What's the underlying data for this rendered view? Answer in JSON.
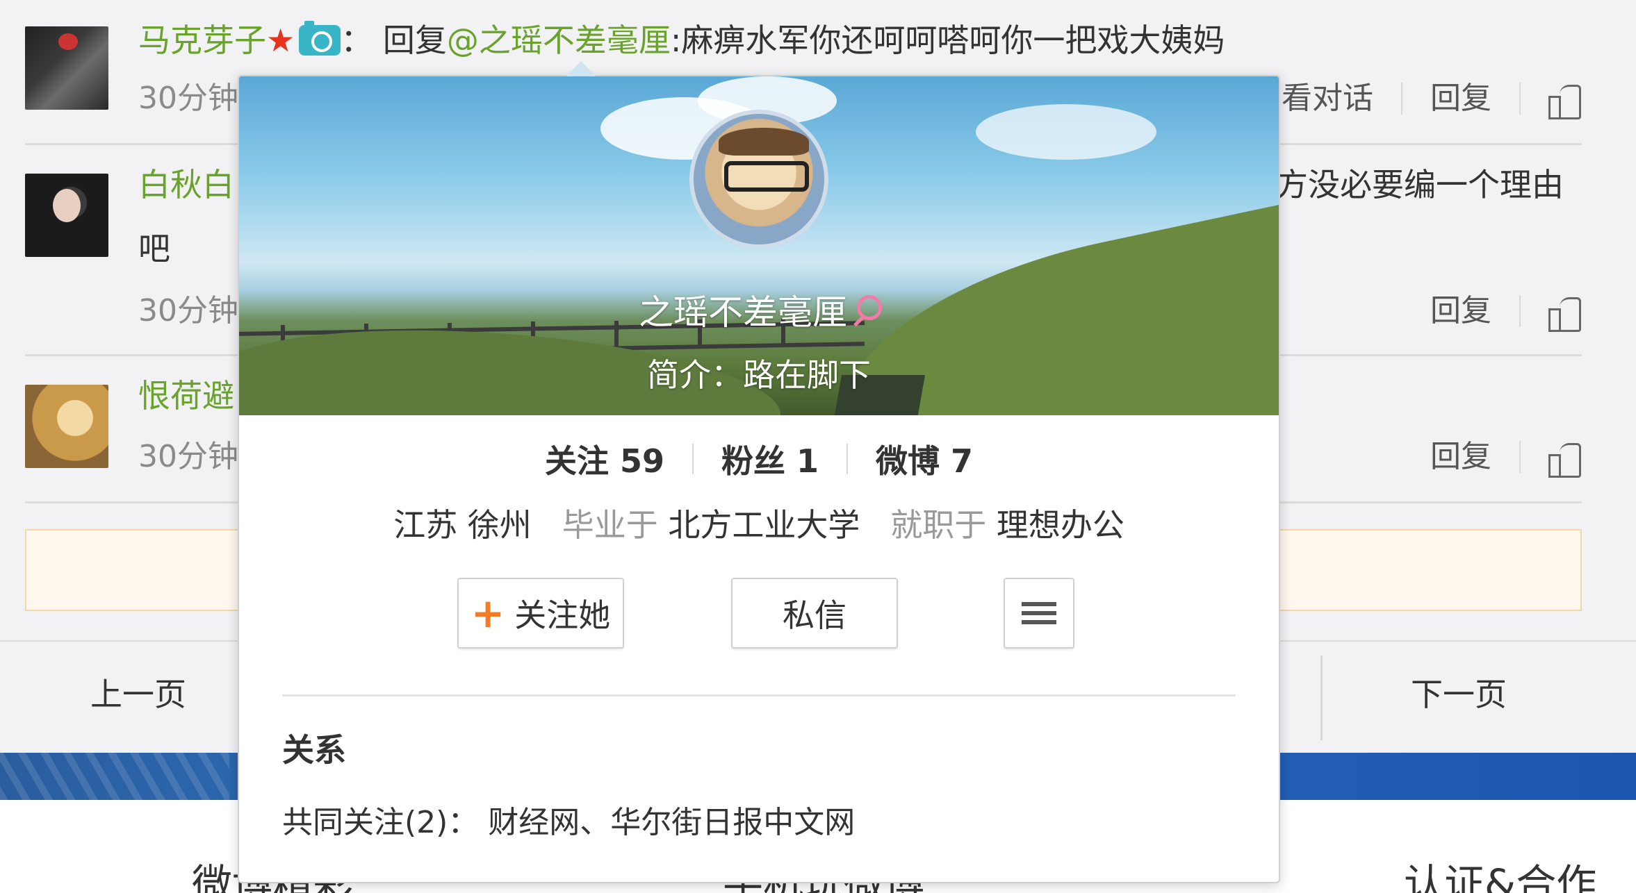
{
  "comments": [
    {
      "user": "马克芽子",
      "separator": "：",
      "reply_prefix": "回复",
      "mention": "@之瑶不差毫厘",
      "text": ":麻痹水军你还呵呵嗒呵你一把戏大姨妈",
      "time": "30分钟",
      "actions": [
        "看对话",
        "回复"
      ],
      "actions_visible_prefix": "看对话"
    },
    {
      "user": "白秋白",
      "text_right": "方没必要编一个理由",
      "text_line2": "吧",
      "time": "30分钟",
      "actions": [
        "回复"
      ]
    },
    {
      "user": "恨荷避",
      "time": "30分钟",
      "actions": [
        "回复"
      ]
    }
  ],
  "pager": {
    "prev": "上一页",
    "next": "下一页"
  },
  "footer": {
    "left": "微博精彩",
    "middle": "手机玩微博",
    "right": "认证&合作"
  },
  "profile_card": {
    "name": "之瑶不差毫厘",
    "bio": "简介：路在脚下",
    "stats": [
      {
        "label": "关注",
        "value": "59"
      },
      {
        "label": "粉丝",
        "value": "1"
      },
      {
        "label": "微博",
        "value": "7"
      }
    ],
    "location": "江苏 徐州",
    "edu_prefix": "毕业于",
    "school": "北方工业大学",
    "job_prefix": "就职于",
    "company": "理想办公",
    "follow_button": "关注她",
    "message_button": "私信",
    "relation_title": "关系",
    "mutual_follow": "共同关注(2)：  财经网、华尔街日报中文网"
  },
  "colors": {
    "name_green": "#6aa32b",
    "follow_plus": "#f57c22",
    "female": "#f27ba8"
  }
}
